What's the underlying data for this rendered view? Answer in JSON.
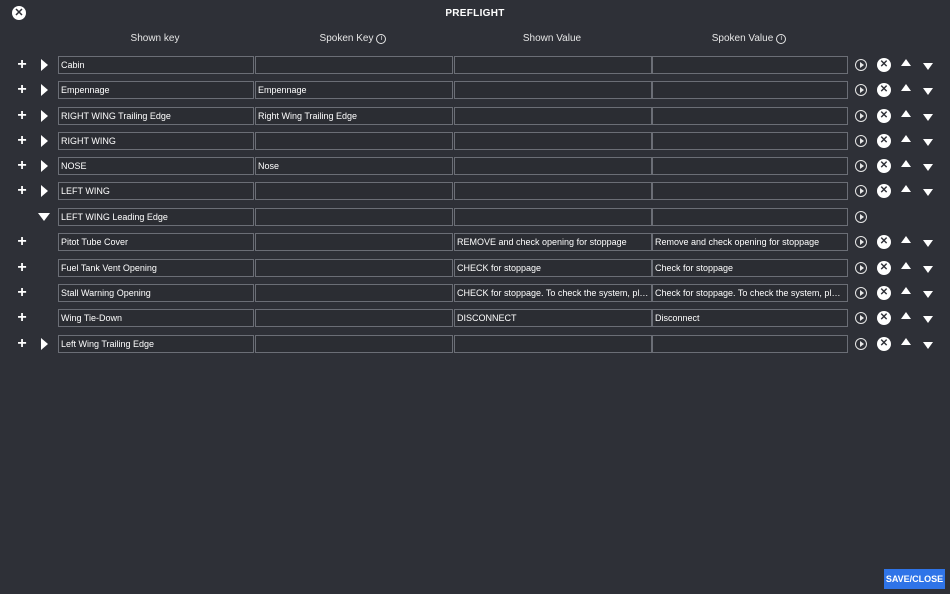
{
  "header": {
    "title": "PREFLIGHT",
    "close_glyph": "✕"
  },
  "columns": {
    "shown_key": "Shown key",
    "spoken_key": "Spoken Key",
    "shown_value": "Shown Value",
    "spoken_value": "Spoken Value",
    "info_glyph": "i"
  },
  "glyphs": {
    "plus": "+",
    "delete": "✕"
  },
  "rows": [
    {
      "shown_key": "Cabin",
      "spoken_key": "",
      "shown_value": "",
      "spoken_value": "",
      "expand": "collapsed",
      "has_plus": true,
      "has_controls": true
    },
    {
      "shown_key": "Empennage",
      "spoken_key": "Empennage",
      "shown_value": "",
      "spoken_value": "",
      "expand": "collapsed",
      "has_plus": true,
      "has_controls": true
    },
    {
      "shown_key": "RIGHT WING Trailing Edge",
      "spoken_key": "Right Wing Trailing Edge",
      "shown_value": "",
      "spoken_value": "",
      "expand": "collapsed",
      "has_plus": true,
      "has_controls": true
    },
    {
      "shown_key": "RIGHT WING",
      "spoken_key": "",
      "shown_value": "",
      "spoken_value": "",
      "expand": "collapsed",
      "has_plus": true,
      "has_controls": true
    },
    {
      "shown_key": "NOSE",
      "spoken_key": "Nose",
      "shown_value": "",
      "spoken_value": "",
      "expand": "collapsed",
      "has_plus": true,
      "has_controls": true
    },
    {
      "shown_key": "LEFT WING",
      "spoken_key": "",
      "shown_value": "",
      "spoken_value": "",
      "expand": "collapsed",
      "has_plus": true,
      "has_controls": true
    },
    {
      "shown_key": "LEFT WING Leading Edge",
      "spoken_key": "",
      "shown_value": "",
      "spoken_value": "",
      "expand": "expanded",
      "has_plus": false,
      "has_controls": false
    },
    {
      "shown_key": "Pitot Tube Cover",
      "spoken_key": "",
      "shown_value": "REMOVE and check opening for stoppage",
      "spoken_value": "Remove and check opening for stoppage",
      "expand": "none",
      "has_plus": true,
      "has_controls": true
    },
    {
      "shown_key": "Fuel Tank Vent Opening",
      "spoken_key": "",
      "shown_value": "CHECK for stoppage",
      "spoken_value": "Check for stoppage",
      "expand": "none",
      "has_plus": true,
      "has_controls": true
    },
    {
      "shown_key": "Stall Warning Opening",
      "spoken_key": "",
      "shown_value": "CHECK for stoppage. To check the system, place…",
      "spoken_value": "Check for stoppage. To check the system, place a…",
      "expand": "none",
      "has_plus": true,
      "has_controls": true
    },
    {
      "shown_key": "Wing Tie-Down",
      "spoken_key": "",
      "shown_value": "DISCONNECT",
      "spoken_value": "Disconnect",
      "expand": "none",
      "has_plus": true,
      "has_controls": true
    },
    {
      "shown_key": "Left Wing Trailing Edge",
      "spoken_key": "",
      "shown_value": "",
      "spoken_value": "",
      "expand": "collapsed",
      "has_plus": true,
      "has_controls": true
    }
  ],
  "footer": {
    "save_label": "SAVE/CLOSE"
  }
}
